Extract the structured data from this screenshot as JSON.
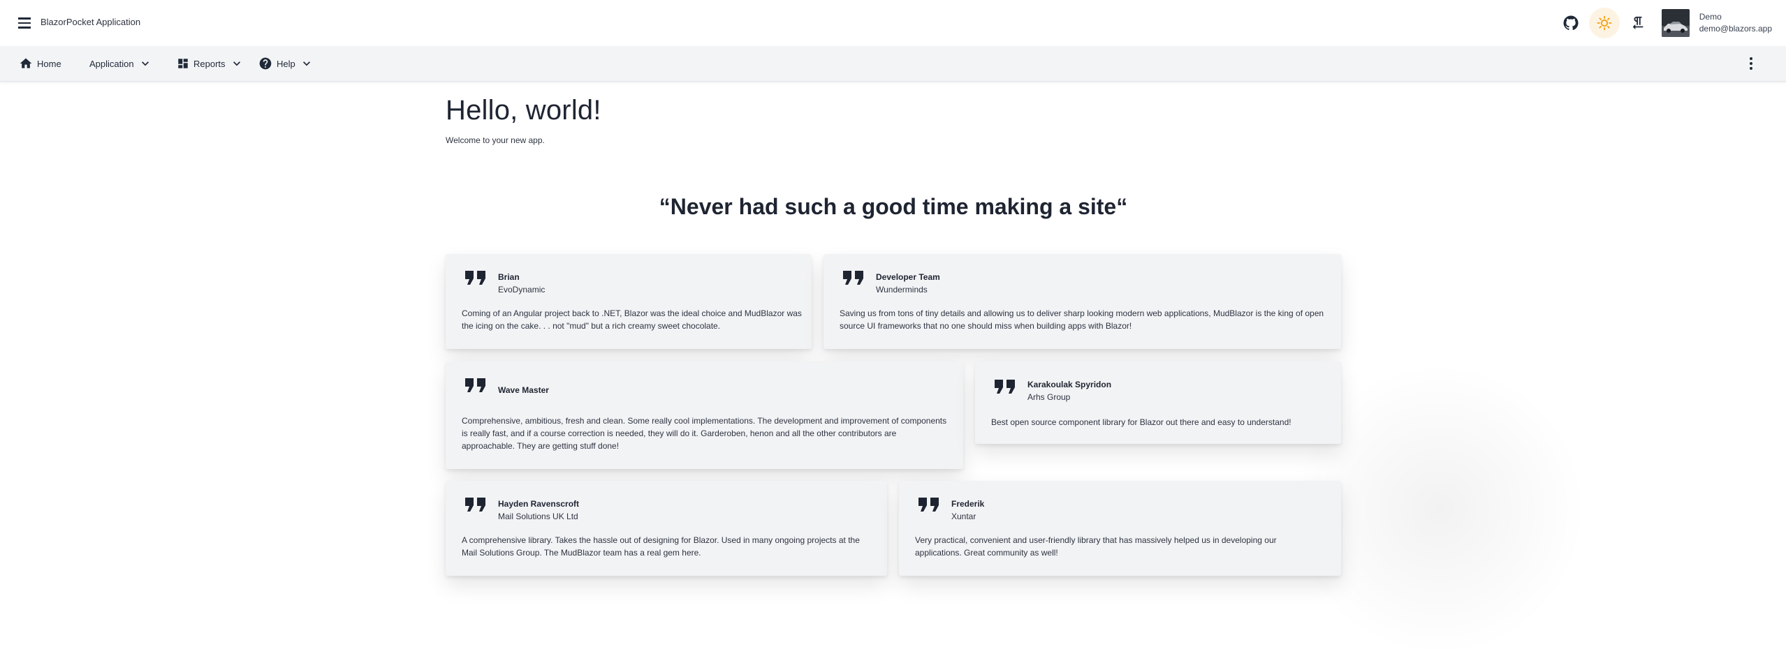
{
  "appbar": {
    "title": "BlazorPocket Application",
    "user": {
      "name": "Demo",
      "email": "demo@blazors.app"
    }
  },
  "nav": {
    "items": [
      {
        "label": "Home",
        "icon": "home-icon"
      },
      {
        "label": "Application",
        "icon": "",
        "has_dropdown": true
      },
      {
        "label": "Reports",
        "icon": "dashboard-icon",
        "has_dropdown": true
      },
      {
        "label": "Help",
        "icon": "help-icon",
        "has_dropdown": true
      }
    ]
  },
  "main": {
    "title": "Hello, world!",
    "subtitle": "Welcome to your new app.",
    "quote_heading": "“Never had such a good time making a site“"
  },
  "testimonials": [
    {
      "name": "Brian",
      "company": "EvoDynamic",
      "text": "Coming of an Angular project back to .NET, Blazor was the ideal choice and MudBlazor was the icing on the cake. . . not \"mud\" but a rich creamy sweet chocolate."
    },
    {
      "name": "Developer Team",
      "company": "Wunderminds",
      "text": "Saving us from tons of tiny details and allowing us to deliver sharp looking modern web applications, MudBlazor is the king of open source UI frameworks that no one should miss when building apps with Blazor!"
    },
    {
      "name": "Wave Master",
      "company": "",
      "text": "Comprehensive, ambitious, fresh and clean. Some really cool implementations. The development and improvement of components is really fast, and if a course correction is needed, they will do it. Garderoben, henon and all the other contributors are approachable. They are getting stuff done!"
    },
    {
      "name": "Karakoulak Spyridon",
      "company": "Arhs Group",
      "text": "Best open source component library for Blazor out there and easy to understand!"
    },
    {
      "name": "Hayden Ravenscroft",
      "company": "Mail Solutions UK Ltd",
      "text": "A comprehensive library. Takes the hassle out of designing for Blazor. Used in many ongoing projects at the Mail Solutions Group. The MudBlazor team has a real gem here."
    },
    {
      "name": "Frederik",
      "company": "Xuntar",
      "text": "Very practical, convenient and user-friendly library that has massively helped us in developing our applications. Great community as well!"
    }
  ],
  "colors": {
    "accent_sun": "#f59e0b",
    "text_dark": "#1e2431",
    "card_bg": "#f2f3f5",
    "navbar_bg": "#f3f4f6"
  }
}
